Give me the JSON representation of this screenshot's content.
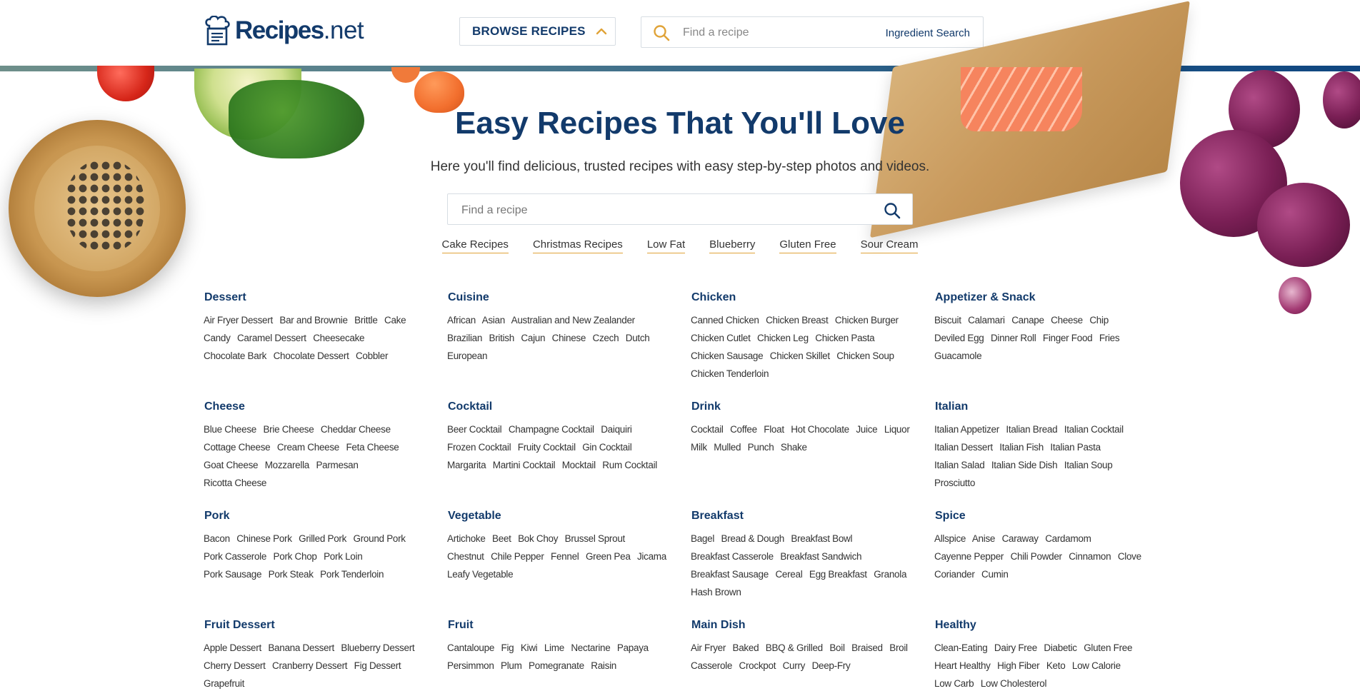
{
  "header": {
    "logo_text_main": "Recipes",
    "logo_text_suffix": ".net",
    "browse_label": "BROWSE RECIPES",
    "search_placeholder": "Find a recipe",
    "ingredient_search_label": "Ingredient Search"
  },
  "colors": {
    "brand_blue": "#123a6b",
    "accent_gold": "#e0a338",
    "stripe_start": "#6e8f8a",
    "stripe_end": "#0f4680"
  },
  "icons": {
    "header_search": "search-icon",
    "browse_chevron": "chevron-up-icon",
    "menu": "hamburger-menu-icon",
    "hero_search": "search-icon"
  },
  "hero": {
    "title": "Easy Recipes That You'll Love",
    "subtitle": "Here you'll find delicious, trusted recipes with easy step-by-step photos and videos.",
    "search_placeholder": "Find a recipe",
    "quick_links": [
      "Cake Recipes",
      "Christmas Recipes",
      "Low Fat",
      "Blueberry",
      "Gluten Free",
      "Sour Cream"
    ]
  },
  "categories": [
    {
      "title": "Dessert",
      "links": [
        "Air Fryer Dessert",
        "Bar and Brownie",
        "Brittle",
        "Cake",
        "Candy",
        "Caramel Dessert",
        "Cheesecake",
        "Chocolate Bark",
        "Chocolate Dessert",
        "Cobbler"
      ]
    },
    {
      "title": "Cuisine",
      "links": [
        "African",
        "Asian",
        "Australian and New Zealander",
        "Brazilian",
        "British",
        "Cajun",
        "Chinese",
        "Czech",
        "Dutch",
        "European"
      ]
    },
    {
      "title": "Chicken",
      "links": [
        "Canned Chicken",
        "Chicken Breast",
        "Chicken Burger",
        "Chicken Cutlet",
        "Chicken Leg",
        "Chicken Pasta",
        "Chicken Sausage",
        "Chicken Skillet",
        "Chicken Soup",
        "Chicken Tenderloin"
      ]
    },
    {
      "title": "Appetizer & Snack",
      "links": [
        "Biscuit",
        "Calamari",
        "Canape",
        "Cheese",
        "Chip",
        "Deviled Egg",
        "Dinner Roll",
        "Finger Food",
        "Fries",
        "Guacamole"
      ]
    },
    {
      "title": "Cheese",
      "links": [
        "Blue Cheese",
        "Brie Cheese",
        "Cheddar Cheese",
        "Cottage Cheese",
        "Cream Cheese",
        "Feta Cheese",
        "Goat Cheese",
        "Mozzarella",
        "Parmesan",
        "Ricotta Cheese"
      ]
    },
    {
      "title": "Cocktail",
      "links": [
        "Beer Cocktail",
        "Champagne Cocktail",
        "Daiquiri",
        "Frozen Cocktail",
        "Fruity Cocktail",
        "Gin Cocktail",
        "Margarita",
        "Martini Cocktail",
        "Mocktail",
        "Rum Cocktail"
      ]
    },
    {
      "title": "Drink",
      "links": [
        "Cocktail",
        "Coffee",
        "Float",
        "Hot Chocolate",
        "Juice",
        "Liquor",
        "Milk",
        "Mulled",
        "Punch",
        "Shake"
      ]
    },
    {
      "title": "Italian",
      "links": [
        "Italian Appetizer",
        "Italian Bread",
        "Italian Cocktail",
        "Italian Dessert",
        "Italian Fish",
        "Italian Pasta",
        "Italian Salad",
        "Italian Side Dish",
        "Italian Soup",
        "Prosciutto"
      ]
    },
    {
      "title": "Pork",
      "links": [
        "Bacon",
        "Chinese Pork",
        "Grilled Pork",
        "Ground Pork",
        "Pork Casserole",
        "Pork Chop",
        "Pork Loin",
        "Pork Sausage",
        "Pork Steak",
        "Pork Tenderloin"
      ]
    },
    {
      "title": "Vegetable",
      "links": [
        "Artichoke",
        "Beet",
        "Bok Choy",
        "Brussel Sprout",
        "Chestnut",
        "Chile Pepper",
        "Fennel",
        "Green Pea",
        "Jicama",
        "Leafy Vegetable"
      ]
    },
    {
      "title": "Breakfast",
      "links": [
        "Bagel",
        "Bread & Dough",
        "Breakfast Bowl",
        "Breakfast Casserole",
        "Breakfast Sandwich",
        "Breakfast Sausage",
        "Cereal",
        "Egg Breakfast",
        "Granola",
        "Hash Brown"
      ]
    },
    {
      "title": "Spice",
      "links": [
        "Allspice",
        "Anise",
        "Caraway",
        "Cardamom",
        "Cayenne Pepper",
        "Chili Powder",
        "Cinnamon",
        "Clove",
        "Coriander",
        "Cumin"
      ]
    },
    {
      "title": "Fruit Dessert",
      "links": [
        "Apple Dessert",
        "Banana Dessert",
        "Blueberry Dessert",
        "Cherry Dessert",
        "Cranberry Dessert",
        "Fig Dessert",
        "Grapefruit"
      ]
    },
    {
      "title": "Fruit",
      "links": [
        "Cantaloupe",
        "Fig",
        "Kiwi",
        "Lime",
        "Nectarine",
        "Papaya",
        "Persimmon",
        "Plum",
        "Pomegranate",
        "Raisin"
      ]
    },
    {
      "title": "Main Dish",
      "links": [
        "Air Fryer",
        "Baked",
        "BBQ & Grilled",
        "Boil",
        "Braised",
        "Broil",
        "Casserole",
        "Crockpot",
        "Curry",
        "Deep-Fry"
      ]
    },
    {
      "title": "Healthy",
      "links": [
        "Clean-Eating",
        "Dairy Free",
        "Diabetic",
        "Gluten Free",
        "Heart Healthy",
        "High Fiber",
        "Keto",
        "Low Calorie",
        "Low Carb",
        "Low Cholesterol"
      ]
    }
  ]
}
